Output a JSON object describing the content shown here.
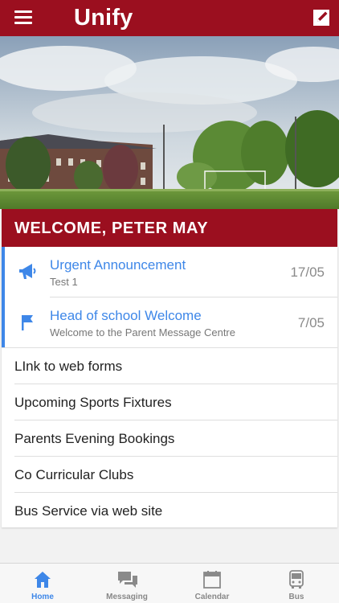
{
  "header": {
    "title": "Unify",
    "menu_icon": "hamburger-menu-icon",
    "compose_icon": "compose-icon"
  },
  "welcome": {
    "text": "WELCOME, PETER MAY"
  },
  "colors": {
    "brand": "#9b0f1f",
    "accent": "#3e87e8"
  },
  "messages": [
    {
      "title": "Urgent Announcement",
      "subtitle": "Test 1",
      "date": "17/05",
      "icon": "megaphone-icon"
    },
    {
      "title": "Head of school Welcome",
      "subtitle": "Welcome to the Parent Message Centre",
      "date": "7/05",
      "icon": "flag-icon"
    }
  ],
  "links": [
    {
      "label": "LInk to web forms"
    },
    {
      "label": "Upcoming Sports Fixtures"
    },
    {
      "label": "Parents Evening Bookings"
    },
    {
      "label": "Co Curricular Clubs"
    },
    {
      "label": "Bus Service via web site"
    }
  ],
  "tabs": [
    {
      "label": "Home",
      "icon": "home-icon",
      "active": true
    },
    {
      "label": "Messaging",
      "icon": "chat-icon",
      "active": false
    },
    {
      "label": "Calendar",
      "icon": "calendar-icon",
      "active": false
    },
    {
      "label": "Bus",
      "icon": "bus-icon",
      "active": false
    }
  ]
}
